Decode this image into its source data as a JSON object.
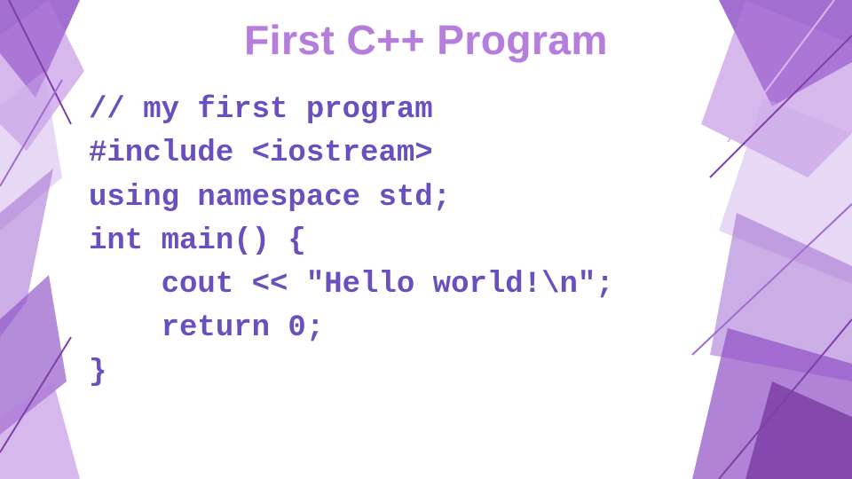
{
  "slide": {
    "title": "First C++ Program"
  },
  "code": {
    "lines": [
      "// my first program",
      "#include <iostream>",
      "using namespace std;",
      "int main() {",
      "    cout << \"Hello world!\\n\";",
      "    return 0;",
      "}"
    ]
  },
  "colors": {
    "title": "#b57edc",
    "code_text": "#6a4fbf",
    "accent_dark": "#7e3fa6",
    "accent_mid": "#a06ccf",
    "accent_light": "#d9b8f0"
  }
}
